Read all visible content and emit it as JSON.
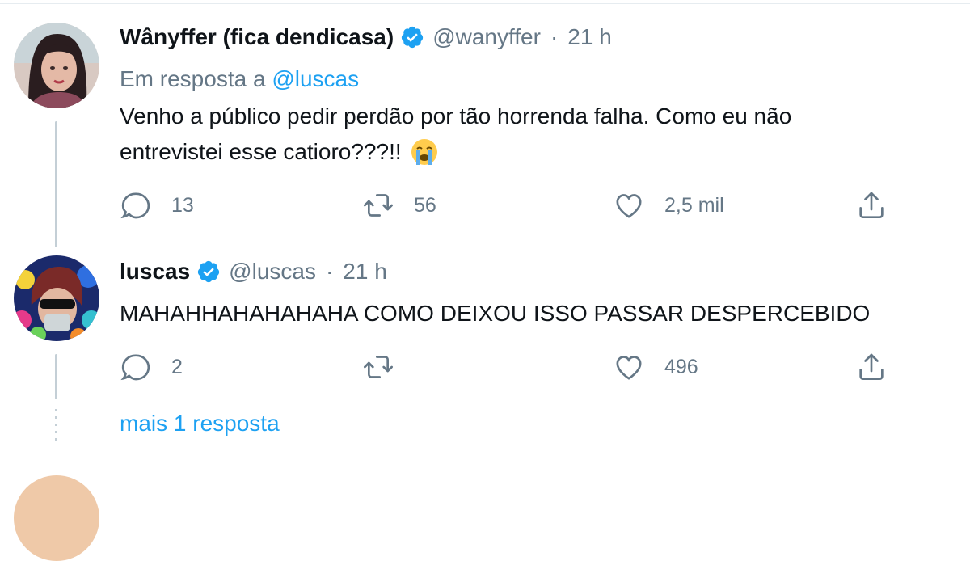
{
  "tweets": [
    {
      "name": "Wânyffer (fica dendicasa)",
      "handle": "@wanyffer",
      "separator": "·",
      "time": "21 h",
      "reply_prefix": "Em resposta a",
      "reply_to": "@luscas",
      "text_line1": "Venho a público pedir perdão por tão horrenda falha. Como eu não",
      "text_line2": "entrevistei esse catioro???!!",
      "emoji": "crying-face",
      "replies": "13",
      "retweets": "56",
      "likes": "2,5 mil"
    },
    {
      "name": "luscas",
      "handle": "@luscas",
      "separator": "·",
      "time": "21 h",
      "text_line1": "MAHAHHAHAHAHAHA COMO DEIXOU ISSO PASSAR DESPERCEBIDO",
      "replies": "2",
      "retweets": "",
      "likes": "496"
    }
  ],
  "more_replies": "mais 1 resposta",
  "colors": {
    "accent": "#1da1f2",
    "muted": "#657786",
    "text": "#0f1419",
    "divider": "#e6ecf0"
  },
  "icons": [
    "verified-icon",
    "reply-icon",
    "retweet-icon",
    "like-icon",
    "share-icon"
  ]
}
